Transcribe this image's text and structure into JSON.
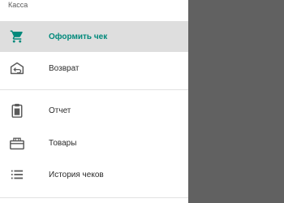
{
  "drawer": {
    "section_label": "Касса",
    "items": [
      {
        "label": "Оформить чек",
        "icon": "cart-icon",
        "active": true
      },
      {
        "label": "Возврат",
        "icon": "return-icon",
        "active": false
      },
      {
        "label": "Отчет",
        "icon": "clipboard-icon",
        "active": false
      },
      {
        "label": "Товары",
        "icon": "products-box-icon",
        "active": false
      },
      {
        "label": "История чеков",
        "icon": "list-icon",
        "active": false
      }
    ]
  },
  "colors": {
    "accent": "#00897b",
    "scrim": "#616161",
    "active_background": "#dedede",
    "icon": "#5a5a5a"
  }
}
